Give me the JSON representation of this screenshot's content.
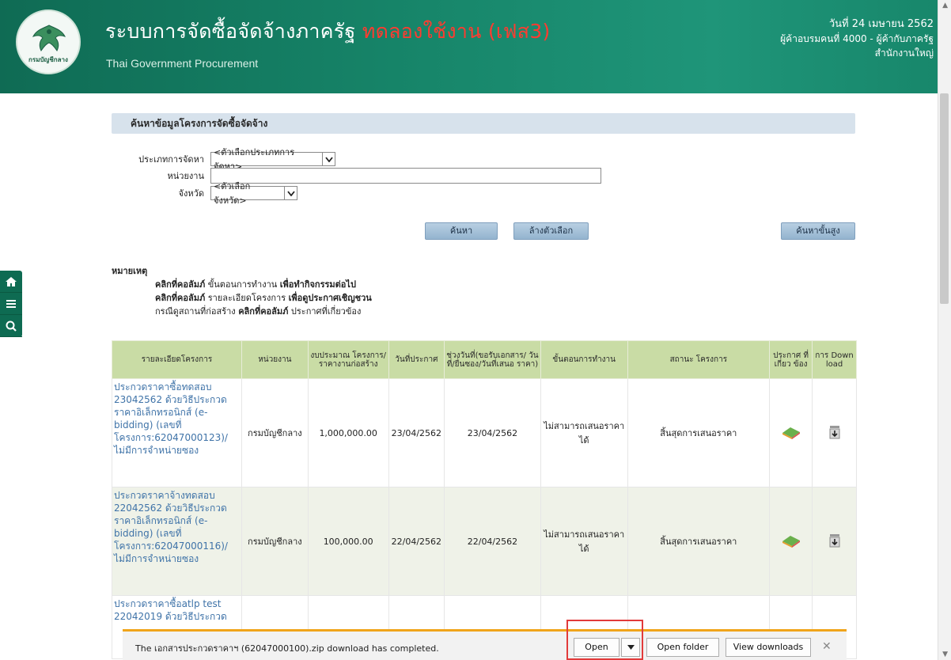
{
  "header": {
    "title": "ระบบการจัดซื้อจัดจ้างภาครัฐ",
    "title_tag": "ทดลองใช้งาน (เฟส3)",
    "subtitle": "Thai Government Procurement",
    "date": "วันที่ 24 เมษายน 2562",
    "user": "ผู้ค้าอบรมคนที่ 4000 - ผู้ค้ากับภาครัฐ",
    "office": "สำนักงานใหญ่",
    "logo_text": "กรมบัญชีกลาง"
  },
  "search": {
    "panel_title": "ค้นหาข้อมูลโครงการจัดซื้อจัดจ้าง",
    "type_label": "ประเภทการจัดหา",
    "type_value": "<ตัวเลือกประเภทการจัดหา>",
    "agency_label": "หน่วยงาน",
    "agency_value": "",
    "province_label": "จังหวัด",
    "province_value": "<ตัวเลือกจังหวัด>",
    "search_btn": "ค้นหา",
    "clear_btn": "ล้างตัวเลือก",
    "advanced_btn": "ค้นหาขั้นสูง"
  },
  "note": {
    "title": "หมายเหตุ",
    "line1_a": "คลิกที่คอลัมภ์",
    "line1_b": "ขั้นตอนการทำงาน",
    "line1_c": "เพื่อทำกิจกรรมต่อไป",
    "line2_a": "คลิกที่คอลัมภ์",
    "line2_b": "รายละเอียดโครงการ",
    "line2_c": "เพื่อดูประกาศเชิญชวน",
    "line3_a": "กรณีดูสถานที่ก่อสร้าง",
    "line3_b": "คลิกที่คอลัมภ์",
    "line3_c": "ประกาศที่เกี่ยวข้อง"
  },
  "table": {
    "headers": {
      "project": "รายละเอียดโครงการ",
      "agency": "หน่วยงาน",
      "budget": "งบประมาณ โครงการ/ ราคางานก่อสร้าง",
      "announce": "วันที่ประกาศ",
      "period": "ช่วงวันที่(ขอรับเอกสาร/ วันที่/ยื่นซอง/วันที่เสนอ ราคา)",
      "step": "ขั้นตอนการทำงาน",
      "status": "สถานะ โครงการ",
      "related": "ประกาศ ที่เกี่ยว ข้อง",
      "download": "การ Down load"
    },
    "rows": [
      {
        "project": "ประกวดราคาซื้อทดสอบ 23042562 ด้วยวิธีประกวดราคาอิเล็กทรอนิกส์ (e-bidding) (เลขที่โครงการ:62047000123)/ไม่มีการจำหน่ายซอง",
        "agency": "กรมบัญชีกลาง",
        "budget": "1,000,000.00",
        "announce": "23/04/2562",
        "period": "23/04/2562",
        "step": "ไม่สามารถเสนอราคาได้",
        "status": "สิ้นสุดการเสนอราคา"
      },
      {
        "project": "ประกวดราคาจ้างทดสอบ 22042562 ด้วยวิธีประกวดราคาอิเล็กทรอนิกส์ (e-bidding) (เลขที่โครงการ:62047000116)/ไม่มีการจำหน่ายซอง",
        "agency": "กรมบัญชีกลาง",
        "budget": "100,000.00",
        "announce": "22/04/2562",
        "period": "22/04/2562",
        "step": "ไม่สามารถเสนอราคาได้",
        "status": "สิ้นสุดการเสนอราคา"
      },
      {
        "project": "ประกวดราคาซื้อatlp test 22042019 ด้วยวิธีประกวด",
        "agency": "",
        "budget": "",
        "announce": "",
        "period": "",
        "step": "",
        "status": ""
      }
    ]
  },
  "download_bar": {
    "message": "The เอกสารประกวดราคาฯ (62047000100).zip download has completed.",
    "open": "Open",
    "open_folder": "Open folder",
    "view_downloads": "View downloads"
  },
  "colors": {
    "header_green": "#17866a",
    "title_tag_red": "#ff3b30",
    "table_header": "#c9dca5",
    "link_blue": "#3f73a8",
    "download_accent": "#f0a41a",
    "highlight": "#e23b3b"
  },
  "icons": [
    "home-icon",
    "menu-icon",
    "search-icon",
    "related-doc-icon",
    "download-icon",
    "close-icon",
    "chevron-down-icon"
  ]
}
